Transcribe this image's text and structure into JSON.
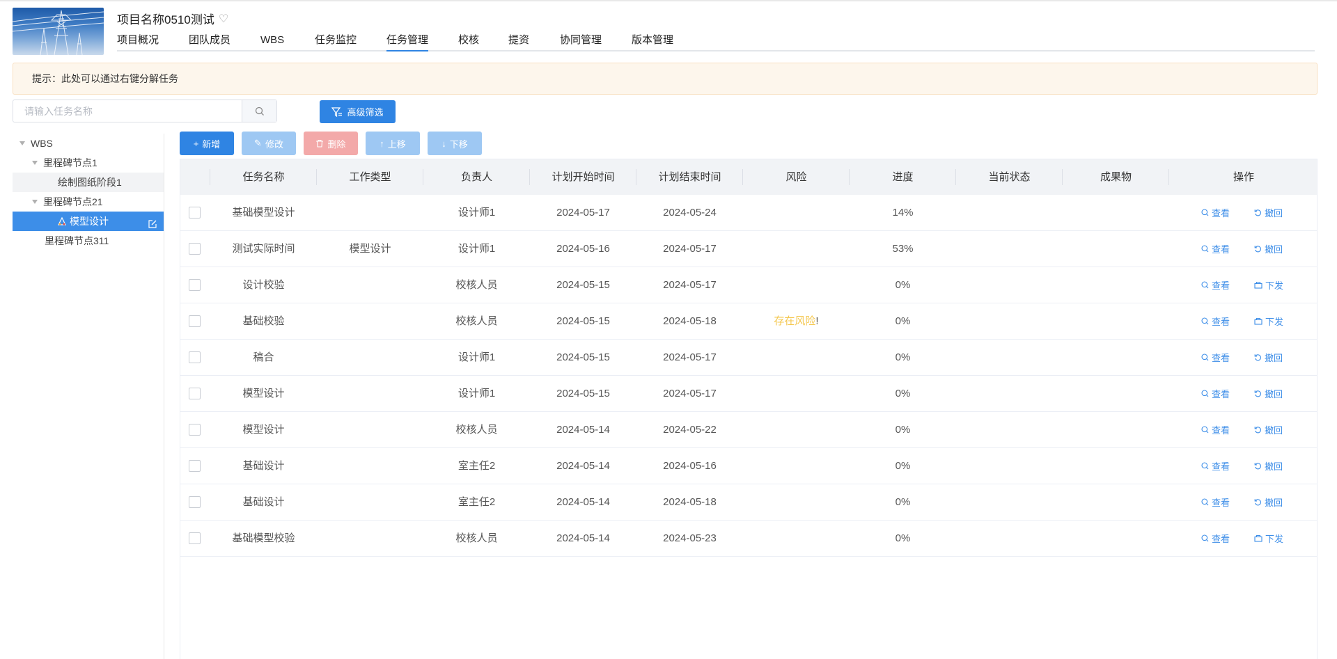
{
  "project": {
    "title": "项目名称0510测试"
  },
  "nav_tabs": [
    "项目概况",
    "团队成员",
    "WBS",
    "任务监控",
    "任务管理",
    "校核",
    "提资",
    "协同管理",
    "版本管理"
  ],
  "active_tab": "任务管理",
  "tip": "提示：此处可以通过右键分解任务",
  "search": {
    "placeholder": "请输入任务名称"
  },
  "advanced_filter_label": "高级筛选",
  "tree": [
    {
      "label": "WBS",
      "level": 0,
      "expanded": true
    },
    {
      "label": "里程碑节点1",
      "level": 1,
      "expanded": true
    },
    {
      "label": "绘制图纸阶段1",
      "level": 2
    },
    {
      "label": "里程碑节点21",
      "level": 1,
      "expanded": true
    },
    {
      "label": "模型设计",
      "level": 2,
      "selected": true
    },
    {
      "label": "里程碑节点311",
      "level": 1
    }
  ],
  "toolbar": {
    "add": "新增",
    "edit": "修改",
    "delete": "删除",
    "up": "上移",
    "down": "下移"
  },
  "table": {
    "columns": [
      "任务名称",
      "工作类型",
      "负责人",
      "计划开始时间",
      "计划结束时间",
      "风险",
      "进度",
      "当前状态",
      "成果物",
      "操作"
    ],
    "rows": [
      {
        "name": "基础模型设计",
        "type": "",
        "owner": "设计师1",
        "start": "2024-05-17",
        "end": "2024-05-24",
        "risk": "",
        "progress": "14%",
        "status": "",
        "output": "",
        "view": "查看",
        "action": "撤回"
      },
      {
        "name": "测试实际时间",
        "type": "模型设计",
        "owner": "设计师1",
        "start": "2024-05-16",
        "end": "2024-05-17",
        "risk": "",
        "progress": "53%",
        "status": "",
        "output": "",
        "view": "查看",
        "action": "撤回"
      },
      {
        "name": "设计校验",
        "type": "",
        "owner": "校核人员",
        "start": "2024-05-15",
        "end": "2024-05-17",
        "risk": "",
        "progress": "0%",
        "status": "",
        "output": "",
        "view": "查看",
        "action": "下发"
      },
      {
        "name": "基础校验",
        "type": "",
        "owner": "校核人员",
        "start": "2024-05-15",
        "end": "2024-05-18",
        "risk": "存在风险",
        "progress": "0%",
        "status": "",
        "output": "",
        "view": "查看",
        "action": "下发"
      },
      {
        "name": "稿合",
        "type": "",
        "owner": "设计师1",
        "start": "2024-05-15",
        "end": "2024-05-17",
        "risk": "",
        "progress": "0%",
        "status": "",
        "output": "",
        "view": "查看",
        "action": "撤回"
      },
      {
        "name": "模型设计",
        "type": "",
        "owner": "设计师1",
        "start": "2024-05-15",
        "end": "2024-05-17",
        "risk": "",
        "progress": "0%",
        "status": "",
        "output": "",
        "view": "查看",
        "action": "撤回"
      },
      {
        "name": "模型设计",
        "type": "",
        "owner": "校核人员",
        "start": "2024-05-14",
        "end": "2024-05-22",
        "risk": "",
        "progress": "0%",
        "status": "",
        "output": "",
        "view": "查看",
        "action": "撤回"
      },
      {
        "name": "基础设计",
        "type": "",
        "owner": "室主任2",
        "start": "2024-05-14",
        "end": "2024-05-16",
        "risk": "",
        "progress": "0%",
        "status": "",
        "output": "",
        "view": "查看",
        "action": "撤回"
      },
      {
        "name": "基础设计",
        "type": "",
        "owner": "室主任2",
        "start": "2024-05-14",
        "end": "2024-05-18",
        "risk": "",
        "progress": "0%",
        "status": "",
        "output": "",
        "view": "查看",
        "action": "撤回"
      },
      {
        "name": "基础模型校验",
        "type": "",
        "owner": "校核人员",
        "start": "2024-05-14",
        "end": "2024-05-23",
        "risk": "",
        "progress": "0%",
        "status": "",
        "output": "",
        "view": "查看",
        "action": "下发"
      }
    ]
  },
  "colors": {
    "primary": "#2f84e3",
    "risk": "#f4c74e",
    "tip_bg": "#fdf6ec",
    "link": "#3d8ee8"
  }
}
